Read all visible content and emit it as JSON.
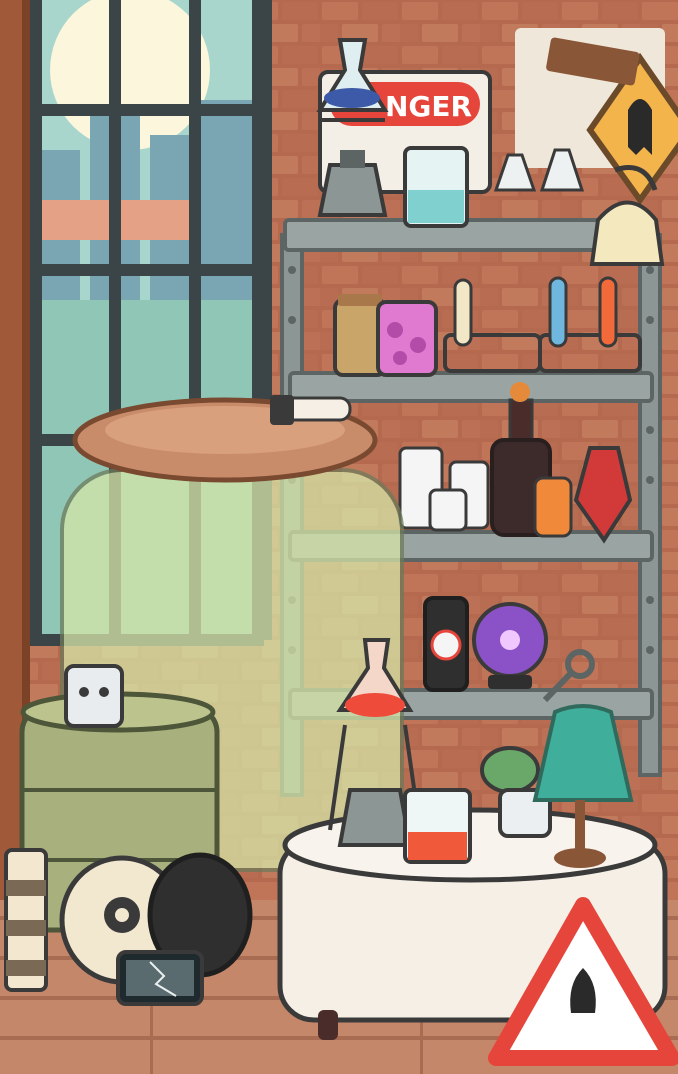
{
  "scene": {
    "wall_sign": {
      "text": "NGER"
    }
  },
  "colors": {
    "brick": "#b5694e",
    "brick_dark": "#9a5640",
    "floor": "#c4876a",
    "floor_dark": "#a86c52",
    "shelf_metal": "#8c9795",
    "shelf_dark": "#5c6563",
    "window_frame": "#3b4548",
    "window_glass": "#a9d6cc",
    "jar_glass": "#d6e6a8",
    "jar_lid": "#c98c6b",
    "table_cloth": "#f5efe6",
    "warning_red": "#e5453a",
    "lamp_green": "#3fae9a"
  },
  "icons": {
    "biohazard": "biohazard-icon",
    "ghost": "ghost-icon",
    "warning": "warning-triangle-icon"
  }
}
